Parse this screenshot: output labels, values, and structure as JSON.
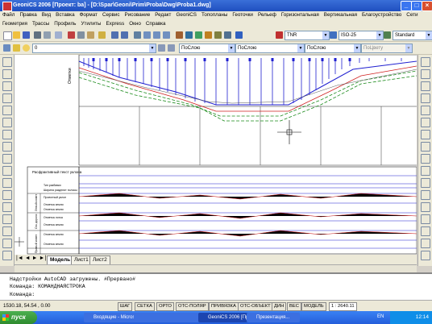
{
  "window": {
    "title": "GeoniCS 2006 [Проект: ba] - [D:\\Spar\\Geoni\\Prim\\Proba\\Dwg\\Proba1.dwg]"
  },
  "menu1": [
    "Файл",
    "Правка",
    "Вид",
    "Вставка",
    "Формат",
    "Сервис",
    "Рисование",
    "Редакт",
    "GeoniCS",
    "Топопланы",
    "Геоточки",
    "Рельеф",
    "Горизонтальная",
    "Вертикальная",
    "Благоустройство",
    "Сети"
  ],
  "menu2": [
    "Геометрия",
    "Трассы",
    "Профиль",
    "Утилиты",
    "Express",
    "Окно",
    "Справка"
  ],
  "toolbar": {
    "text_style": "TNR",
    "dim_style": "ISO-25",
    "table_style": "Standard"
  },
  "props": {
    "layer": "0",
    "color": "ПоСлою",
    "linetype": "ПоСлою",
    "lineweight": "ПоСлою",
    "plotstyle": "ПоЦвету"
  },
  "drawing": {
    "stamp": "Отметки",
    "tbl_title": "Расфрактивный текст уклона",
    "row_labels": [
      "Тип разбивки",
      "Ширина разделит полосы",
      "Проектный уклон",
      "Отметка земли",
      "Отметка земли",
      "Отметка лотка",
      "Отметка земли",
      "Отметка земли",
      "Отметка земли"
    ],
    "group_labels": [
      "Левый кювет",
      "Ось дороги",
      "Правый кювет"
    ]
  },
  "tabs": [
    "Модель",
    "Лист1",
    "Лист2"
  ],
  "command": {
    "line1": "Надстройки AutoCAD загружены. #Прервано#",
    "line2": "Команда: КОМАНДНАЯСТРОКА",
    "line3": "Команда:"
  },
  "status": {
    "coords": "1530.18, 54.54 , 0.00",
    "buttons": [
      "ШАГ",
      "СЕТКА",
      "ОРТО",
      "ОТС-ПОЛЯР",
      "ПРИВЯЗКА",
      "ОТС-ОБЪЕКТ",
      "ДИН",
      "ВЕС",
      "МОДЕЛЬ"
    ],
    "scale": "1 : 2640.11"
  },
  "taskbar": {
    "start": "пуск",
    "tasks": [
      "Входящие - Microsof...",
      "",
      "",
      "",
      "",
      "",
      "GeoniCS 2006 [Проект...",
      "Презентация..."
    ],
    "lang": "EN",
    "clock": "12:14"
  },
  "colors": {
    "titlebar": "#245edb",
    "profile_blue": "#2020d0",
    "profile_green": "#1a8a1a",
    "profile_red": "#d02020"
  }
}
